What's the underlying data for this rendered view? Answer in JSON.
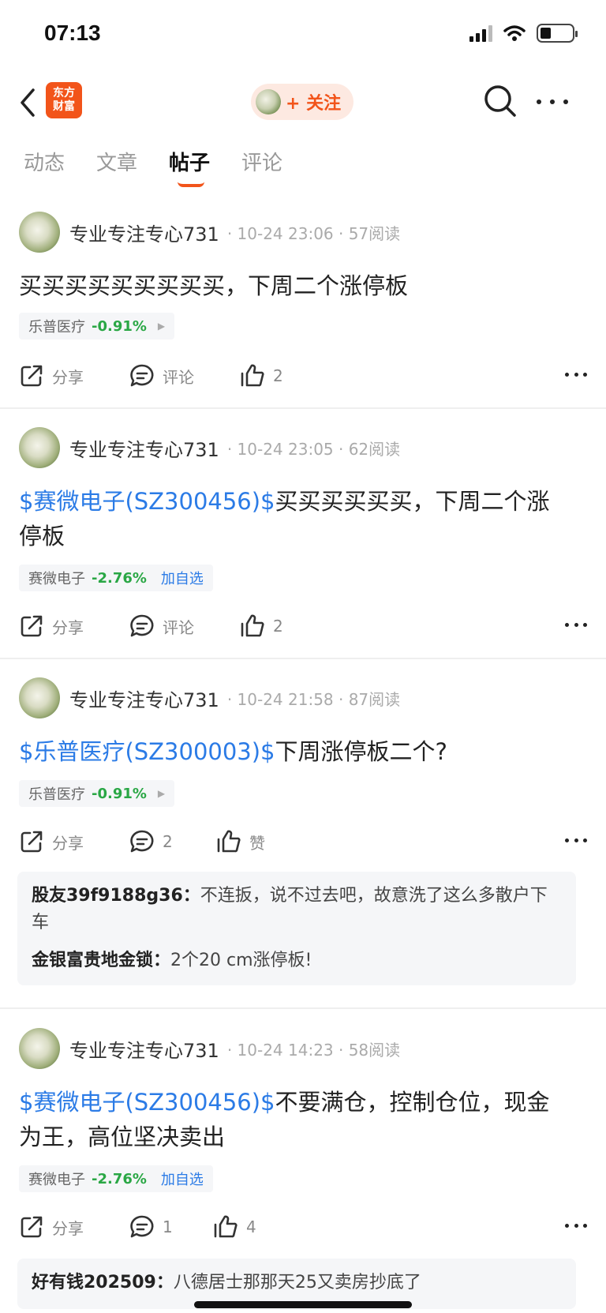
{
  "status_bar": {
    "time": "07:13"
  },
  "nav": {
    "logo_line1": "东方",
    "logo_line2": "财富",
    "follow_label": "+ 关注"
  },
  "tabs": [
    {
      "label": "动态"
    },
    {
      "label": "文章"
    },
    {
      "label": "帖子"
    },
    {
      "label": "评论"
    }
  ],
  "active_tab": "帖子",
  "posts": [
    {
      "author": "专业专注专心731",
      "meta": "· 10-24 23:06 · 57阅读",
      "link": "",
      "text": "买买买买买买买买买，下周二个涨停板",
      "tag_name": "乐普医疗",
      "tag_change": "-0.91%",
      "tag_add": "",
      "share": "分享",
      "comment": "评论",
      "like": "2",
      "comments": []
    },
    {
      "author": "专业专注专心731",
      "meta": "· 10-24 23:05 · 62阅读",
      "link": "$赛微电子(SZ300456)$",
      "text": "买买买买买买，下周二个涨停板",
      "tag_name": "赛微电子",
      "tag_change": "-2.76%",
      "tag_add": "加自选",
      "share": "分享",
      "comment": "评论",
      "like": "2",
      "comments": []
    },
    {
      "author": "专业专注专心731",
      "meta": "· 10-24 21:58 · 87阅读",
      "link": "$乐普医疗(SZ300003)$",
      "text": "下周涨停板二个?",
      "tag_name": "乐普医疗",
      "tag_change": "-0.91%",
      "tag_add": "",
      "share": "分享",
      "comment": "2",
      "like": "赞",
      "comments": [
        {
          "user": "股友39f9188g36：",
          "text": "不连扳，说不过去吧，故意洗了这么多散户下车"
        },
        {
          "user": "金银富贵地金锁：",
          "text": "2个20 cm涨停板!"
        }
      ]
    },
    {
      "author": "专业专注专心731",
      "meta": "· 10-24 14:23 · 58阅读",
      "link": "$赛微电子(SZ300456)$",
      "text": "不要满仓，控制仓位，现金为王，高位坚决卖出",
      "tag_name": "赛微电子",
      "tag_change": "-2.76%",
      "tag_add": "加自选",
      "share": "分享",
      "comment": "1",
      "like": "4",
      "comments": [
        {
          "user": "好有钱202509：",
          "text": "八德居士那那天25又卖房抄底了"
        }
      ]
    }
  ],
  "colors": {
    "accent": "#f2541a",
    "link": "#2b7be6",
    "down": "#2aa745"
  }
}
